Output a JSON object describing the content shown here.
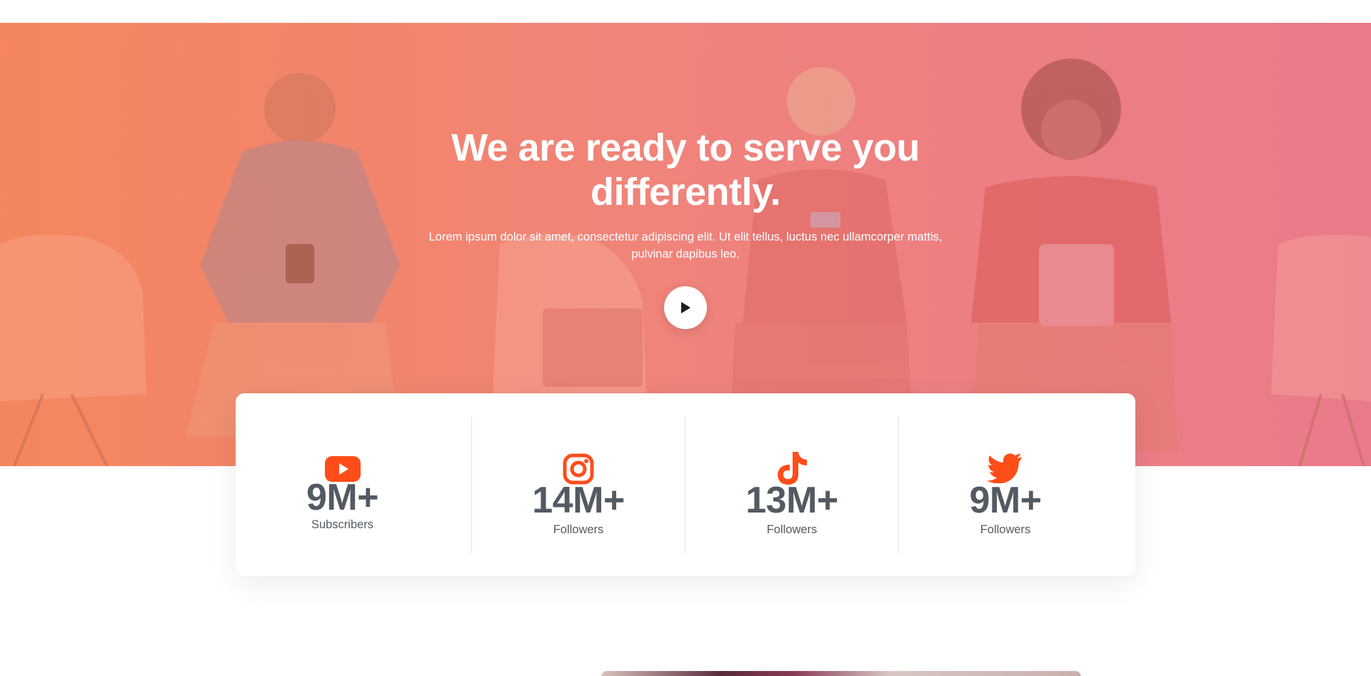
{
  "hero": {
    "title": "We are ready to serve you differently.",
    "subtitle": "Lorem ipsum dolor sit amet, consectetur adipiscing elit. Ut elit tellus, luctus nec ullamcorper mattis, pulvinar dapibus leo.",
    "play_icon": "play-icon"
  },
  "stats": [
    {
      "icon": "youtube-icon",
      "value": "9M+",
      "label": "Subscribers"
    },
    {
      "icon": "instagram-icon",
      "value": "14M+",
      "label": "Followers"
    },
    {
      "icon": "tiktok-icon",
      "value": "13M+",
      "label": "Followers"
    },
    {
      "icon": "twitter-icon",
      "value": "9M+",
      "label": "Followers"
    }
  ],
  "colors": {
    "accent": "#ff4d1a",
    "stat_text": "#535a62",
    "hero_overlay_left": "#f38a62",
    "hero_overlay_right": "#ea7c8a"
  }
}
